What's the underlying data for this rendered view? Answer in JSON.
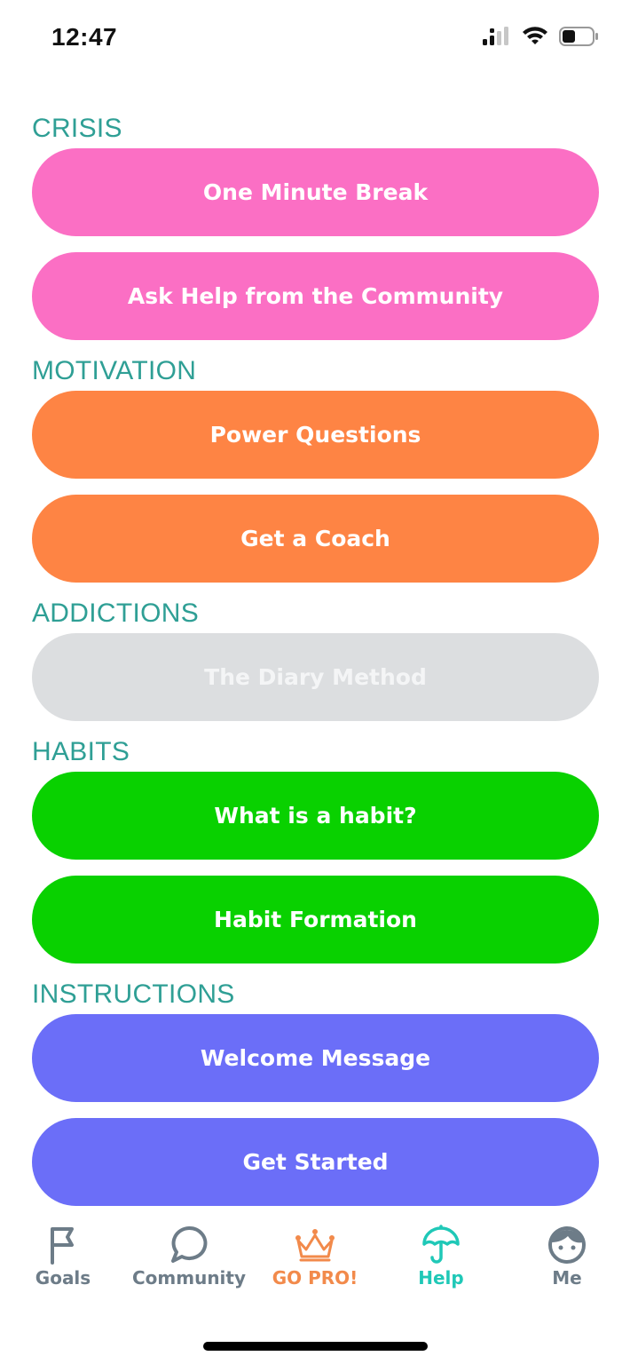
{
  "status_bar": {
    "time": "12:47"
  },
  "sections": [
    {
      "title": "CRISIS",
      "buttons": [
        "One Minute Break",
        "Ask Help from the Community"
      ]
    },
    {
      "title": "MOTIVATION",
      "buttons": [
        "Power Questions",
        "Get a Coach"
      ]
    },
    {
      "title": "ADDICTIONS",
      "buttons": [
        "The Diary Method"
      ]
    },
    {
      "title": "HABITS",
      "buttons": [
        "What is a habit?",
        "Habit Formation"
      ]
    },
    {
      "title": "INSTRUCTIONS",
      "buttons": [
        "Welcome Message",
        "Get Started"
      ]
    }
  ],
  "colors": {
    "section_title": "#2f9f95",
    "crisis": "#fb6fc4",
    "motivation": "#fe8444",
    "addictions_disabled": "#dcdee0",
    "habits": "#09d100",
    "instructions": "#6b6ef8",
    "tab_inactive": "#6d7c88",
    "tab_active": "#1fc8b7",
    "tab_pro": "#f28a4b"
  },
  "tabbar": {
    "items": [
      {
        "label": "Goals",
        "icon": "flag-icon"
      },
      {
        "label": "Community",
        "icon": "chat-bubble-icon"
      },
      {
        "label": "GO PRO!",
        "icon": "crown-icon"
      },
      {
        "label": "Help",
        "icon": "umbrella-icon",
        "active": true
      },
      {
        "label": "Me",
        "icon": "face-icon"
      }
    ]
  }
}
